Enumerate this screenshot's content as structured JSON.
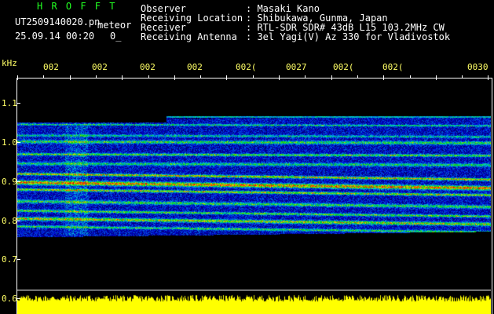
{
  "header": {
    "brand": "H R O F F T",
    "filename": "UT2509140020.pn",
    "tag": "meteor",
    "datetime": "25.09.14 00:20",
    "extra": "0_"
  },
  "info": {
    "observer_label": "Observer",
    "observer_value": ": Masaki Kano",
    "location_label": "Receiving Location",
    "location_value": ": Shibukawa, Gunma, Japan",
    "receiver_label": "Receiver",
    "receiver_value": ": RTL-SDR SDR# 43dB L15 103.2MHz CW",
    "antenna_label": "Receiving Antenna",
    "antenna_value": ": 3el Yagi(V) Az 330 for Vladivostok"
  },
  "axis": {
    "unit": "kHz",
    "time_ticks": [
      "002",
      "002",
      "002",
      "002",
      "002(",
      "0027",
      "002(",
      "002(",
      "0030"
    ],
    "freq_labels": [
      "1.1",
      "1.0",
      "0.9",
      "0.8",
      "0.7",
      "0.6"
    ]
  },
  "colors": {
    "background": "#000000",
    "signal": "#ffff00",
    "brand": "#22ff22",
    "tick_label": "#ffff66"
  }
}
